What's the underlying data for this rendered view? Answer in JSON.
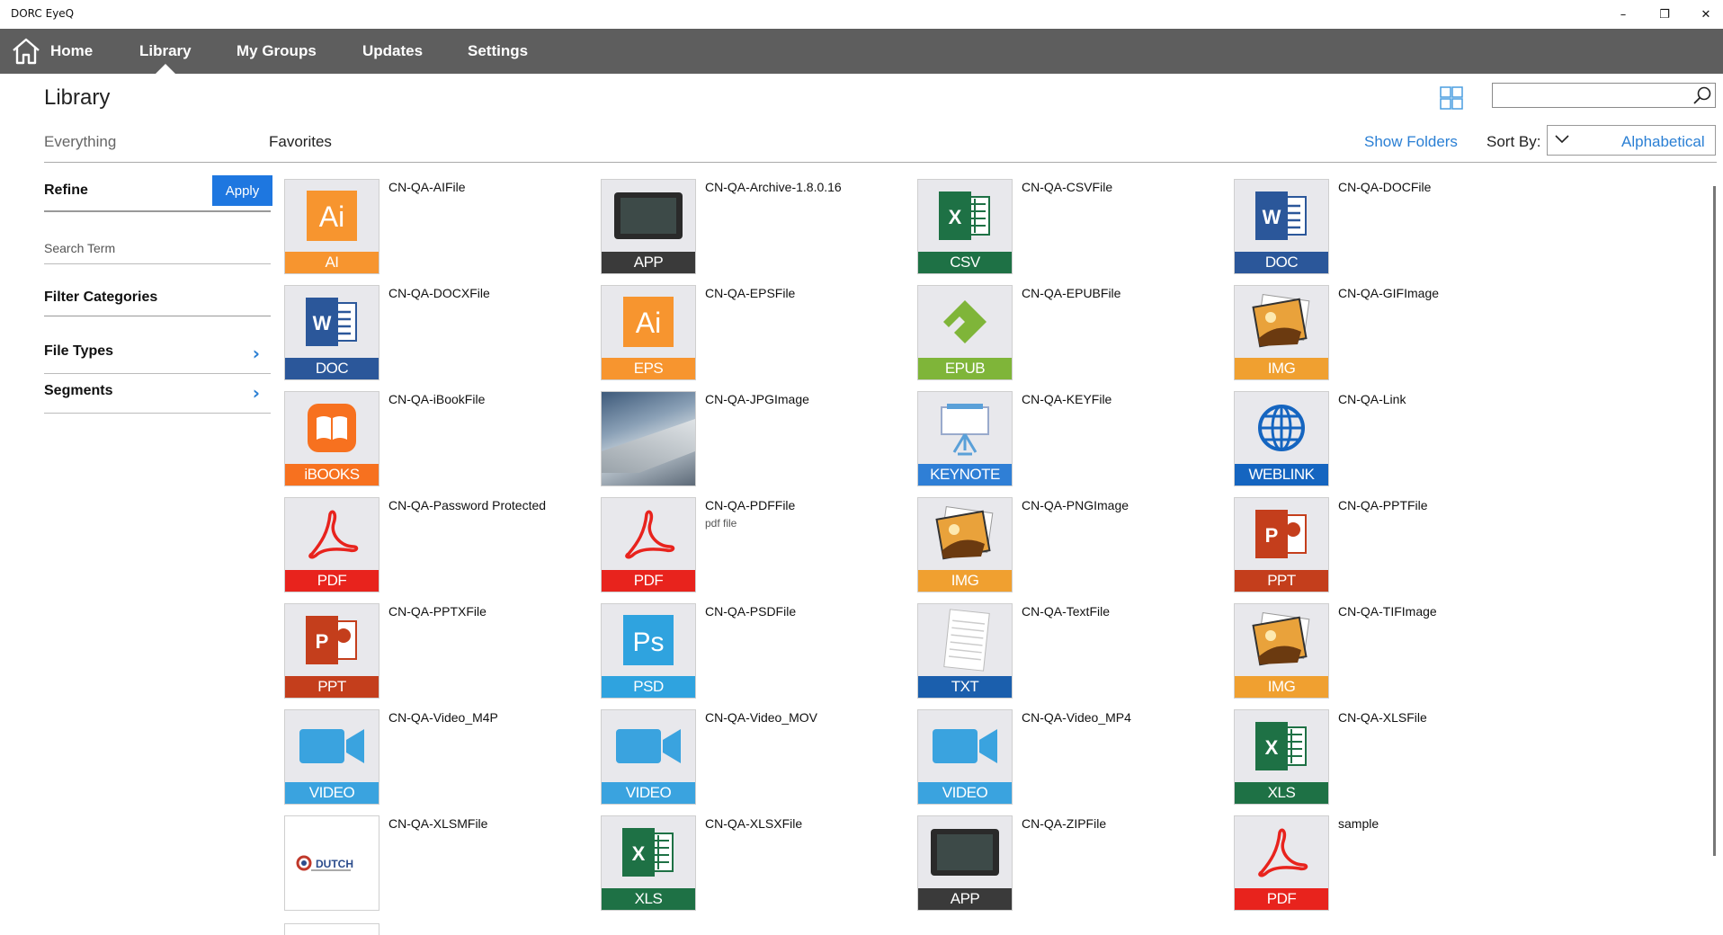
{
  "window": {
    "title": "DORC EyeQ"
  },
  "nav": {
    "home": "Home",
    "library": "Library",
    "my_groups": "My Groups",
    "updates": "Updates",
    "settings": "Settings"
  },
  "header": {
    "title": "Library",
    "tab_everything": "Everything",
    "tab_favorites": "Favorites",
    "show_folders": "Show Folders",
    "sort_label": "Sort By:",
    "sort_value": "Alphabetical",
    "search_value": ""
  },
  "sidebar": {
    "refine": "Refine",
    "apply": "Apply",
    "search_term_placeholder": "Search Term",
    "filter_categories": "Filter Categories",
    "file_types": "File Types",
    "segments": "Segments"
  },
  "files": [
    {
      "name": "CN-QA-AIFile",
      "label": "AI",
      "icon": "illustrator-icon",
      "color": "#f7952f"
    },
    {
      "name": "CN-QA-Archive-1.8.0.16",
      "label": "APP",
      "icon": "app-icon",
      "color": "#3a3a3a"
    },
    {
      "name": "CN-QA-CSVFile",
      "label": "CSV",
      "icon": "excel-icon",
      "color": "#1e7145"
    },
    {
      "name": "CN-QA-DOCFile",
      "label": "DOC",
      "icon": "word-icon",
      "color": "#2b579a"
    },
    {
      "name": "CN-QA-DOCXFile",
      "label": "DOC",
      "icon": "word-icon",
      "color": "#2b579a"
    },
    {
      "name": "CN-QA-EPSFile",
      "label": "EPS",
      "icon": "illustrator-icon",
      "color": "#f7952f"
    },
    {
      "name": "CN-QA-EPUBFile",
      "label": "EPUB",
      "icon": "epub-icon",
      "color": "#7fb539"
    },
    {
      "name": "CN-QA-GIFImage",
      "label": "IMG",
      "icon": "image-icon",
      "color": "#f0a030"
    },
    {
      "name": "CN-QA-iBookFile",
      "label": "iBOOKS",
      "icon": "ibooks-icon",
      "color": "#f7711f"
    },
    {
      "name": "CN-QA-JPGImage",
      "label": "",
      "icon": "photo-thumbnail",
      "color": "#7a8a99"
    },
    {
      "name": "CN-QA-KEYFile",
      "label": "KEYNOTE",
      "icon": "keynote-icon",
      "color": "#2f7fd6"
    },
    {
      "name": "CN-QA-Link",
      "label": "WEBLINK",
      "icon": "globe-icon",
      "color": "#1565c0"
    },
    {
      "name": "CN-QA-Password Protected",
      "label": "PDF",
      "icon": "pdf-icon",
      "color": "#e8231d"
    },
    {
      "name": "CN-QA-PDFFile",
      "label": "PDF",
      "icon": "pdf-icon",
      "color": "#e8231d",
      "sub": "pdf file"
    },
    {
      "name": "CN-QA-PNGImage",
      "label": "IMG",
      "icon": "image-icon",
      "color": "#f0a030"
    },
    {
      "name": "CN-QA-PPTFile",
      "label": "PPT",
      "icon": "powerpoint-icon",
      "color": "#c43e1c"
    },
    {
      "name": "CN-QA-PPTXFile",
      "label": "PPT",
      "icon": "powerpoint-icon",
      "color": "#c43e1c"
    },
    {
      "name": "CN-QA-PSDFile",
      "label": "PSD",
      "icon": "photoshop-icon",
      "color": "#2fa3df"
    },
    {
      "name": "CN-QA-TextFile",
      "label": "TXT",
      "icon": "text-icon",
      "color": "#1b5fad"
    },
    {
      "name": "CN-QA-TIFImage",
      "label": "IMG",
      "icon": "image-icon",
      "color": "#f0a030"
    },
    {
      "name": "CN-QA-Video_M4P",
      "label": "VIDEO",
      "icon": "video-icon",
      "color": "#3aa3df"
    },
    {
      "name": "CN-QA-Video_MOV",
      "label": "VIDEO",
      "icon": "video-icon",
      "color": "#3aa3df"
    },
    {
      "name": "CN-QA-Video_MP4",
      "label": "VIDEO",
      "icon": "video-icon",
      "color": "#3aa3df"
    },
    {
      "name": "CN-QA-XLSFile",
      "label": "XLS",
      "icon": "excel-icon",
      "color": "#1e7145"
    },
    {
      "name": "CN-QA-XLSMFile",
      "label": "",
      "icon": "dutch-logo-thumbnail",
      "color": "#ffffff",
      "logo_text": "DUTCH"
    },
    {
      "name": "CN-QA-XLSXFile",
      "label": "XLS",
      "icon": "excel-icon",
      "color": "#1e7145"
    },
    {
      "name": "CN-QA-ZIPFile",
      "label": "APP",
      "icon": "app-icon",
      "color": "#3a3a3a"
    },
    {
      "name": "sample",
      "label": "PDF",
      "icon": "pdf-icon",
      "color": "#e8231d"
    }
  ]
}
